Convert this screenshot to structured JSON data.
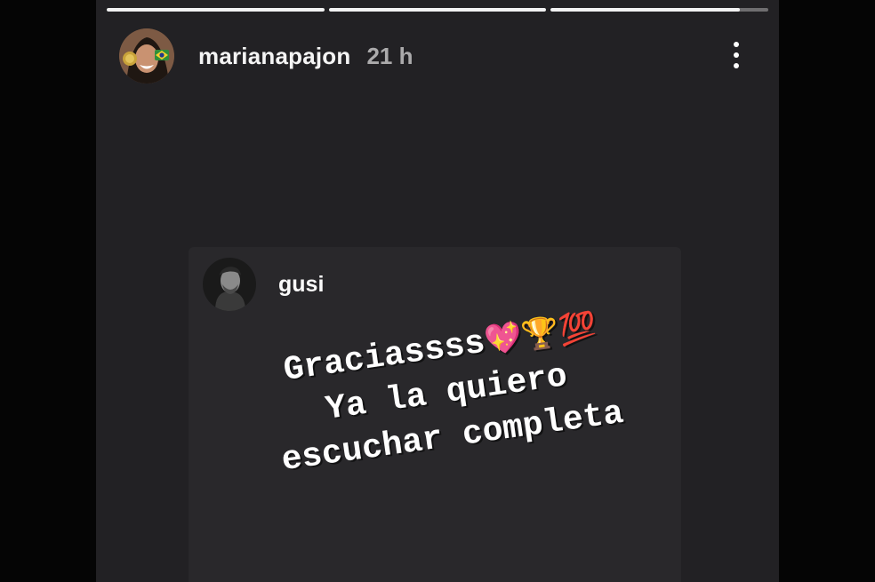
{
  "story": {
    "progress": [
      1.0,
      1.0,
      0.87
    ],
    "username": "marianapajon",
    "time_ago": "21 h",
    "more_icon": "more-vertical-icon"
  },
  "reply": {
    "username": "gusi",
    "line1_text": "Graciassss",
    "line1_emojis": "💖🏆💯",
    "line2": "Ya la quiero",
    "line3": "escuchar completa"
  },
  "colors": {
    "story_background": "#222124",
    "card_background": "#29282b",
    "text": "#ffffff",
    "muted_text": "#a0a0a0"
  }
}
